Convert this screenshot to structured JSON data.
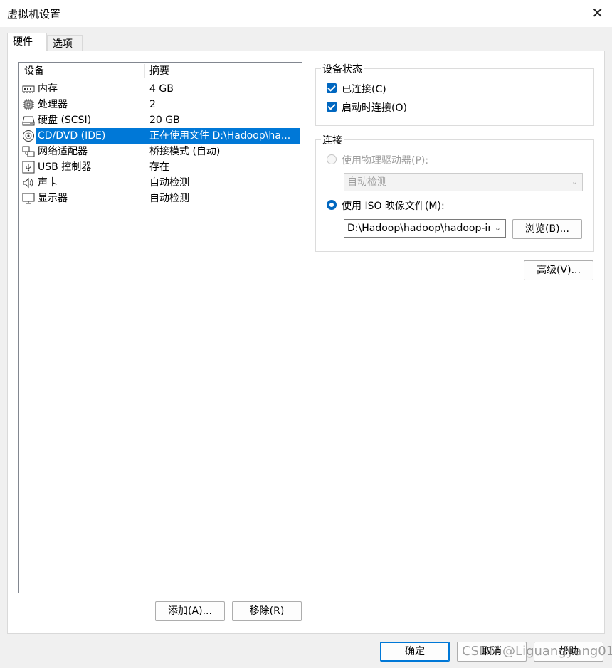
{
  "window": {
    "title": "虚拟机设置",
    "close_glyph": "✕"
  },
  "tabs": [
    {
      "label": "硬件"
    },
    {
      "label": "选项"
    }
  ],
  "device_list": {
    "headers": {
      "device": "设备",
      "summary": "摘要"
    },
    "rows": [
      {
        "name": "内存",
        "summary": "4 GB",
        "icon": "memory-icon"
      },
      {
        "name": "处理器",
        "summary": "2",
        "icon": "cpu-icon"
      },
      {
        "name": "硬盘 (SCSI)",
        "summary": "20 GB",
        "icon": "hard-disk-icon"
      },
      {
        "name": "CD/DVD (IDE)",
        "summary": "正在使用文件 D:\\Hadoop\\ha...",
        "icon": "cd-dvd-icon",
        "selected": true
      },
      {
        "name": "网络适配器",
        "summary": "桥接模式 (自动)",
        "icon": "network-adapter-icon"
      },
      {
        "name": "USB 控制器",
        "summary": "存在",
        "icon": "usb-icon"
      },
      {
        "name": "声卡",
        "summary": "自动检测",
        "icon": "speaker-icon"
      },
      {
        "name": "显示器",
        "summary": "自动检测",
        "icon": "monitor-icon"
      }
    ]
  },
  "list_buttons": {
    "add": "添加(A)...",
    "remove": "移除(R)"
  },
  "device_status": {
    "title": "设备状态",
    "connected": {
      "label": "已连接(C)",
      "checked": true
    },
    "connect_on_start": {
      "label": "启动时连接(O)",
      "checked": true
    }
  },
  "connection": {
    "title": "连接",
    "physical": {
      "label": "使用物理驱动器(P):",
      "selected": false,
      "enabled": false
    },
    "physical_select": "自动检测",
    "iso": {
      "label": "使用 ISO 映像文件(M):",
      "selected": true
    },
    "iso_path": "D:\\Hadoop\\hadoop\\hadoop-ins",
    "browse": "浏览(B)..."
  },
  "advanced": "高级(V)...",
  "footer": {
    "ok": "确定",
    "cancel": "取消",
    "help": "帮助"
  },
  "watermark": "CSDN @Liguangyang01",
  "colors": {
    "accent": "#0078d7",
    "checkbox": "#0067c0"
  }
}
